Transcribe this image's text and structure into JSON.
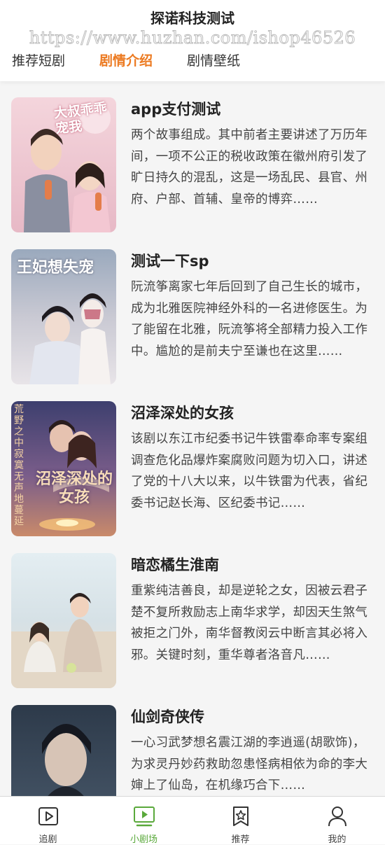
{
  "header": {
    "title": "探诺科技测试",
    "watermark": "https://www.huzhan.com/ishop46526"
  },
  "tabs": [
    {
      "label": "推荐短剧",
      "active": false
    },
    {
      "label": "剧情介绍",
      "active": true
    },
    {
      "label": "剧情壁纸",
      "active": false
    }
  ],
  "colors": {
    "active_tab": "#ec7a21",
    "active_nav": "#5aa93b"
  },
  "dramas": [
    {
      "title": "app支付测试",
      "desc": "两个故事组成。其中前者主要讲述了万历年间，一项不公正的税收政策在徽州府引发了旷日持久的混乱，这是一场乱民、县官、州府、户部、首辅、皇帝的博弈……",
      "poster_text": "大叔乖乖宠我"
    },
    {
      "title": "测试一下sp",
      "desc": "阮流筝离家七年后回到了自己生长的城市，成为北雅医院神经外科的一名进修医生。为了能留在北雅，阮流筝将全部精力投入工作中。尴尬的是前夫宁至谦也在这里……",
      "poster_text": "王妃想失宠"
    },
    {
      "title": "沼泽深处的女孩",
      "desc": "该剧以东江市纪委书记牛铁雷奉命率专案组调查危化品爆炸案腐败问题为切入口，讲述了党的十八大以来，以牛铁雷为代表，省纪委书记赵长海、区纪委书记……",
      "poster_text": "沼泽深处的女孩",
      "poster_side_text": "荒野之中寂寞无声地蔓延"
    },
    {
      "title": "暗恋橘生淮南",
      "desc": "重紫纯洁善良，却是逆轮之女，因被云君子楚不复所救励志上南华求学，却因天生煞气 被拒之门外，南华督教闵云中断言其必将入邪。关键时刻，重华尊者洛音凡……",
      "poster_text": ""
    },
    {
      "title": "仙剑奇侠传",
      "desc": "一心习武梦想名震江湖的李逍遥(胡歌饰)，为求灵丹妙药救助忽患怪病相依为命的李大婶上了仙岛，在机缘巧合下……",
      "poster_text": ""
    }
  ],
  "nav": [
    {
      "label": "追剧",
      "icon": "play-square-icon",
      "active": false
    },
    {
      "label": "小剧场",
      "icon": "tv-play-icon",
      "active": true
    },
    {
      "label": "推荐",
      "icon": "star-bookmark-icon",
      "active": false
    },
    {
      "label": "我的",
      "icon": "user-icon",
      "active": false
    }
  ]
}
